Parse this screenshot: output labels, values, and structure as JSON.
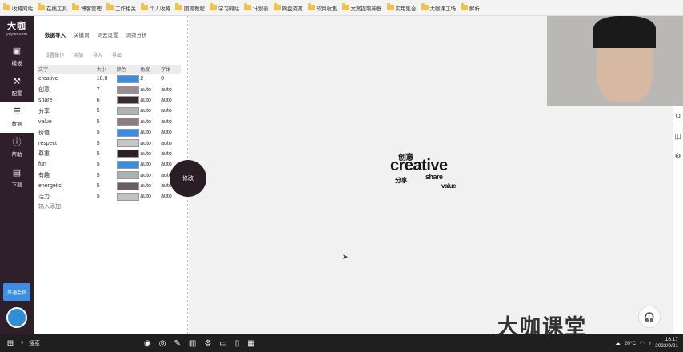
{
  "bookmarks": [
    "收藏网站",
    "在线工具",
    "博客管理",
    "工作相关",
    "个人收藏",
    "图源教程",
    "学习网站",
    "计划表",
    "网盘资源",
    "软件收集",
    "文案提取神器",
    "实用集合",
    "大咖课工场",
    "解析"
  ],
  "sidebar": {
    "brand": "大咖",
    "url": "ydyun.com",
    "items": [
      {
        "label": "模板",
        "icon": "template-icon",
        "glyph": "▣"
      },
      {
        "label": "配置",
        "icon": "wrench-icon",
        "glyph": "⚒"
      },
      {
        "label": "数据",
        "icon": "database-icon",
        "glyph": "☰"
      },
      {
        "label": "帮助",
        "icon": "info-icon",
        "glyph": "ⓘ"
      },
      {
        "label": "下载",
        "icon": "download-icon",
        "glyph": "▤"
      }
    ],
    "bottom_button": "开通会员"
  },
  "panel": {
    "tabs": [
      "数据导入",
      "关键词",
      "词云设置",
      "词频分析"
    ],
    "toolbar": [
      "设置操作",
      "添加",
      "导入",
      "导出"
    ],
    "columns": [
      "文字",
      "大小",
      "颜色",
      "角度",
      "字体"
    ],
    "rows": [
      {
        "word": "creative",
        "size": "18.8",
        "color": "#3b8de0",
        "angle": "2",
        "font": "0"
      },
      {
        "word": "创意",
        "size": "7",
        "color": "#9c8b8f",
        "angle": "auto",
        "font": "auto"
      },
      {
        "word": "share",
        "size": "6",
        "color": "#3a2a33",
        "angle": "auto",
        "font": "auto"
      },
      {
        "word": "分享",
        "size": "5",
        "color": "#b3b3b3",
        "angle": "auto",
        "font": "auto"
      },
      {
        "word": "value",
        "size": "5",
        "color": "#8a7e80",
        "angle": "auto",
        "font": "auto"
      },
      {
        "word": "价值",
        "size": "5",
        "color": "#3b8de0",
        "angle": "auto",
        "font": "auto"
      },
      {
        "word": "respect",
        "size": "5",
        "color": "#c6c6c6",
        "angle": "auto",
        "font": "auto"
      },
      {
        "word": "尊重",
        "size": "5",
        "color": "#2e1f2b",
        "angle": "auto",
        "font": "auto"
      },
      {
        "word": "fun",
        "size": "5",
        "color": "#3b8de0",
        "angle": "auto",
        "font": "auto"
      },
      {
        "word": "有趣",
        "size": "5",
        "color": "#b0b0b0",
        "angle": "auto",
        "font": "auto"
      },
      {
        "word": "energetic",
        "size": "5",
        "color": "#6b5d63",
        "angle": "auto",
        "font": "auto"
      },
      {
        "word": "活力",
        "size": "5",
        "color": "#c2c2c2",
        "angle": "auto",
        "font": "auto"
      }
    ],
    "add_row": "输入添加"
  },
  "canvas": {
    "modify_button": "修改",
    "cloud_words": [
      "creative",
      "创意",
      "share",
      "分享",
      "value"
    ]
  },
  "watermark": "大咖课堂",
  "taskbar": {
    "search": "搜索",
    "weather": "20°C",
    "time": "16:17",
    "date": "2023/9/21"
  }
}
